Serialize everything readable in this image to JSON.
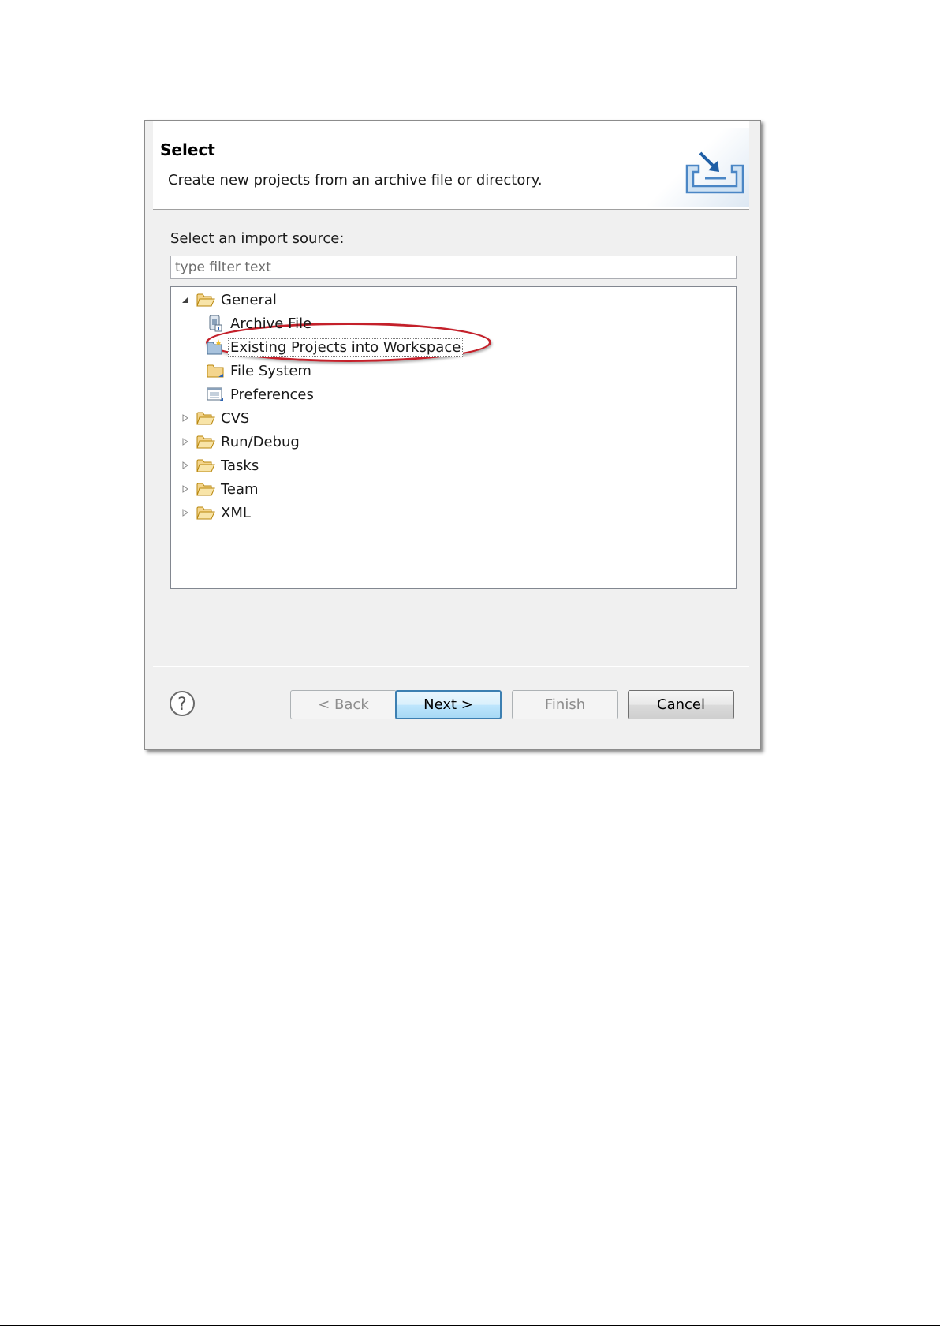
{
  "header": {
    "title": "Select",
    "description": "Create new projects from an archive file or directory.",
    "art_icon": "import-wizard-icon"
  },
  "source": {
    "label": "Select an import source:",
    "filter_placeholder": "type filter text",
    "filter_value": ""
  },
  "tree": {
    "items": [
      {
        "label": "General",
        "icon": "open-folder-icon",
        "expanded": true,
        "level": 0
      },
      {
        "label": "Archive File",
        "icon": "archive-file-icon",
        "level": 1
      },
      {
        "label": "Existing Projects into Workspace",
        "icon": "project-icon",
        "level": 1,
        "selected": true,
        "annotated": true
      },
      {
        "label": "File System",
        "icon": "folder-icon",
        "level": 1
      },
      {
        "label": "Preferences",
        "icon": "preferences-icon",
        "level": 1
      },
      {
        "label": "CVS",
        "icon": "open-folder-icon",
        "expanded": false,
        "level": 0
      },
      {
        "label": "Run/Debug",
        "icon": "open-folder-icon",
        "expanded": false,
        "level": 0
      },
      {
        "label": "Tasks",
        "icon": "open-folder-icon",
        "expanded": false,
        "level": 0
      },
      {
        "label": "Team",
        "icon": "open-folder-icon",
        "expanded": false,
        "level": 0
      },
      {
        "label": "XML",
        "icon": "open-folder-icon",
        "expanded": false,
        "level": 0
      }
    ]
  },
  "buttons": {
    "back": "< Back",
    "next": "Next >",
    "finish": "Finish",
    "cancel": "Cancel"
  },
  "colors": {
    "annotation_ring": "#c4202a",
    "primary_button_border": "#3c7fb1",
    "folder": "#e8b84a"
  }
}
